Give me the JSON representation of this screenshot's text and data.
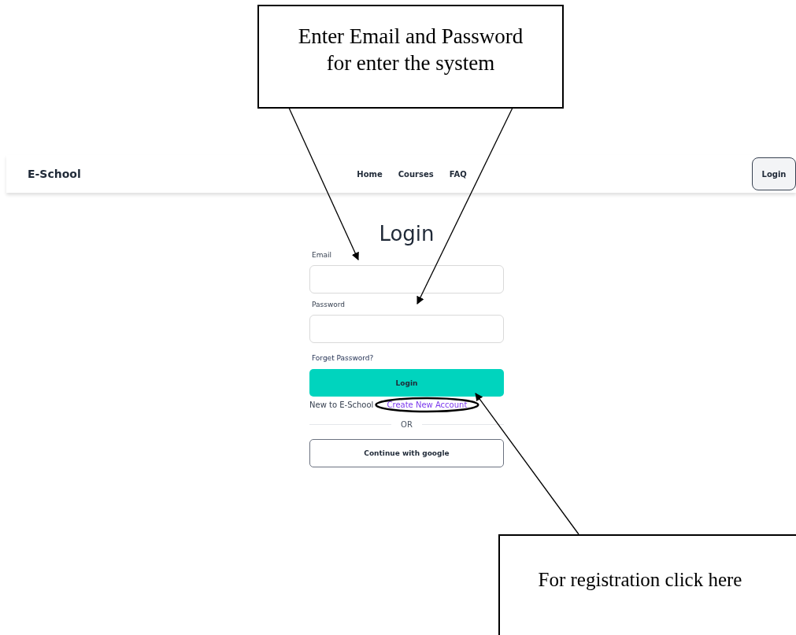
{
  "header": {
    "logo": "E-School",
    "nav": [
      "Home",
      "Courses",
      "FAQ"
    ],
    "login_button": "Login"
  },
  "form": {
    "title": "Login",
    "fields": [
      {
        "label": "Email"
      },
      {
        "label": "Password"
      }
    ],
    "forgot_link": "Forget Password?",
    "submit_button": "Login",
    "signup_text": "New to E-School",
    "signup_link": "Create New Account",
    "divider": "OR",
    "google_button": "Continue with google"
  },
  "annotations": [
    {
      "kind": "callout",
      "text": "Enter Email and Password\nfor enter the system"
    },
    {
      "kind": "callout",
      "text": "For registration click here"
    }
  ]
}
